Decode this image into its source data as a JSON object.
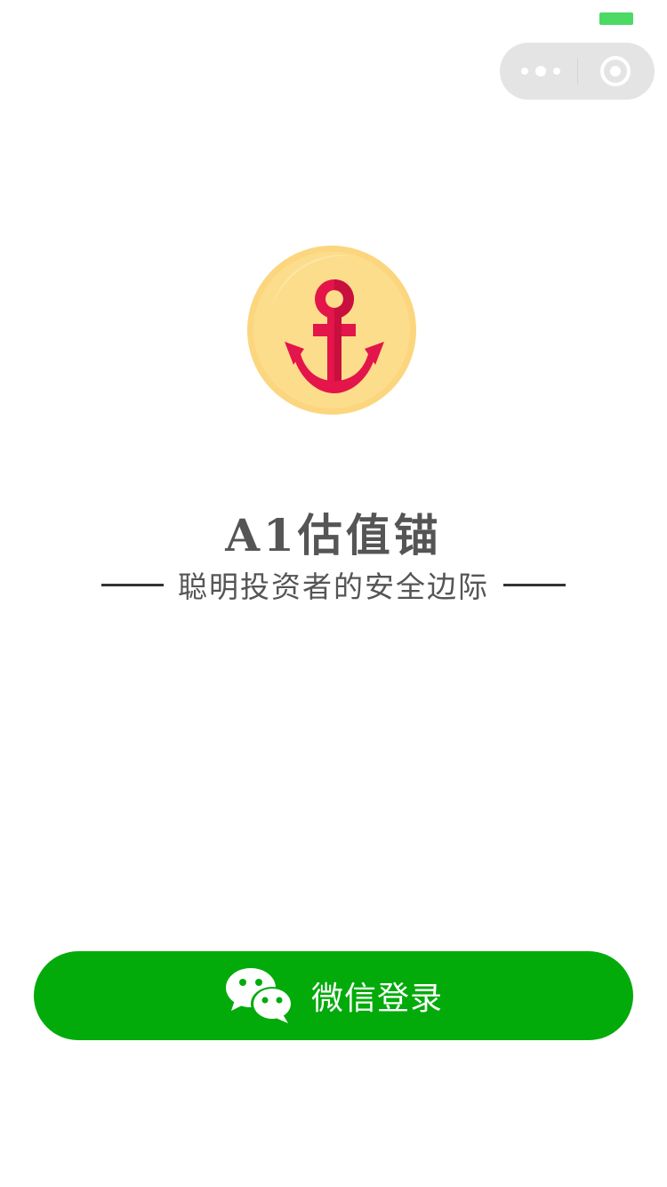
{
  "status_bar": {
    "battery_color": "#4cd964"
  },
  "capsule": {
    "more_icon": "more-dots-icon",
    "close_icon": "target-close-icon"
  },
  "logo": {
    "icon": "anchor-icon",
    "coin_color": "#fbd67e",
    "anchor_color": "#e3154a"
  },
  "app": {
    "name": "A1估值锚",
    "tagline": "聪明投资者的安全边际"
  },
  "login_button": {
    "label": "微信登录",
    "icon": "wechat-icon",
    "color": "#02ab0a"
  }
}
